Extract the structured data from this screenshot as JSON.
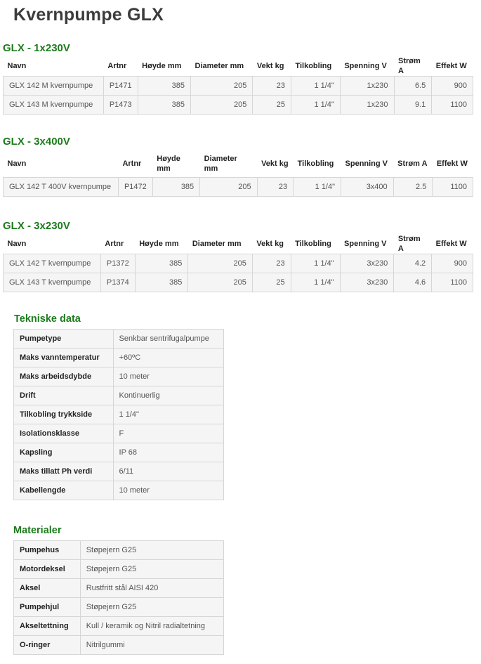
{
  "title": "Kvernpumpe GLX",
  "sections": [
    {
      "heading": "GLX - 1x230V",
      "headers": [
        "Navn",
        "Artnr",
        "Høyde mm",
        "Diameter mm",
        "Vekt kg",
        "Tilkobling",
        "Spenning V",
        "Strøm A",
        "Effekt W"
      ],
      "rows": [
        [
          "GLX 142 M kvernpumpe",
          "P1471",
          "385",
          "205",
          "23",
          "1 1/4\"",
          "1x230",
          "6.5",
          "900"
        ],
        [
          "GLX 143 M kvernpumpe",
          "P1473",
          "385",
          "205",
          "25",
          "1 1/4\"",
          "1x230",
          "9.1",
          "1100"
        ]
      ]
    },
    {
      "heading": "GLX - 3x400V",
      "headers": [
        "Navn",
        "Artnr",
        "Høyde mm",
        "Diameter mm",
        "Vekt kg",
        "Tilkobling",
        "Spenning V",
        "Strøm A",
        "Effekt W"
      ],
      "rows": [
        [
          "GLX 142 T 400V kvernpumpe",
          "P1472",
          "385",
          "205",
          "23",
          "1 1/4\"",
          "3x400",
          "2.5",
          "1100"
        ]
      ]
    },
    {
      "heading": "GLX - 3x230V",
      "headers": [
        "Navn",
        "Artnr",
        "Høyde mm",
        "Diameter mm",
        "Vekt kg",
        "Tilkobling",
        "Spenning V",
        "Strøm A",
        "Effekt W"
      ],
      "rows": [
        [
          "GLX 142 T kvernpumpe",
          "P1372",
          "385",
          "205",
          "23",
          "1 1/4\"",
          "3x230",
          "4.2",
          "900"
        ],
        [
          "GLX 143 T kvernpumpe",
          "P1374",
          "385",
          "205",
          "25",
          "1 1/4\"",
          "3x230",
          "4.6",
          "1100"
        ]
      ]
    }
  ],
  "tekniske": {
    "heading": "Tekniske data",
    "rows": [
      [
        "Pumpetype",
        "Senkbar sentrifugalpumpe"
      ],
      [
        "Maks vanntemperatur",
        "+60ºC"
      ],
      [
        "Maks arbeidsdybde",
        "10 meter"
      ],
      [
        "Drift",
        "Kontinuerlig"
      ],
      [
        "Tilkobling trykkside",
        "1 1/4\""
      ],
      [
        "Isolationsklasse",
        "F"
      ],
      [
        "Kapsling",
        "IP 68"
      ],
      [
        "Maks tillatt Ph verdi",
        "6/11"
      ],
      [
        "Kabellengde",
        "10 meter"
      ]
    ]
  },
  "materialer": {
    "heading": "Materialer",
    "rows": [
      [
        "Pumpehus",
        "Støpejern G25"
      ],
      [
        "Motordeksel",
        "Støpejern G25"
      ],
      [
        "Aksel",
        "Rustfritt stål AISI 420"
      ],
      [
        "Pumpehjul",
        "Støpejern G25"
      ],
      [
        "Akseltettning",
        "Kull / keramik og Nitril radialtetning"
      ],
      [
        "O-ringer",
        "Nitrilgummi"
      ]
    ]
  }
}
